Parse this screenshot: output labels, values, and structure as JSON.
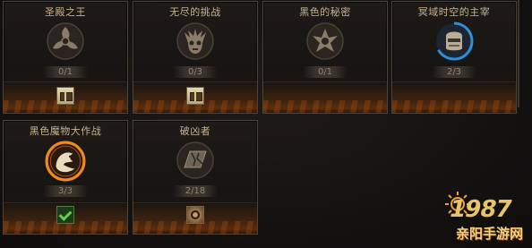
{
  "achievements": [
    {
      "title": "圣殿之王",
      "progress": "0/1",
      "icon": "spinning-blade-icon",
      "reward": "chest-icon",
      "completed": false
    },
    {
      "title": "无尽的挑战",
      "progress": "0/3",
      "icon": "demon-skull-icon",
      "reward": "chest-icon",
      "completed": false
    },
    {
      "title": "黑色的秘密",
      "progress": "0/1",
      "icon": "dark-emblem-icon",
      "reward": "",
      "completed": false
    },
    {
      "title": "冥域时空的主宰",
      "progress": "2/3",
      "icon": "armored-helm-icon",
      "reward": "",
      "completed": false
    },
    {
      "title": "黑色魔物大作战",
      "progress": "3/3",
      "icon": "dragon-sigil-icon",
      "reward": "checkmark-icon",
      "completed": true
    },
    {
      "title": "破凶者",
      "progress": "2/18",
      "icon": "cracked-slab-icon",
      "reward": "claw-badge-icon",
      "completed": false
    }
  ],
  "colors": {
    "title": "#c9b48e",
    "completed_ring": "#f08a1e",
    "progress_ring": "#2f8fd6"
  },
  "watermark": {
    "number": "1987",
    "name": "亲阳手游网"
  }
}
